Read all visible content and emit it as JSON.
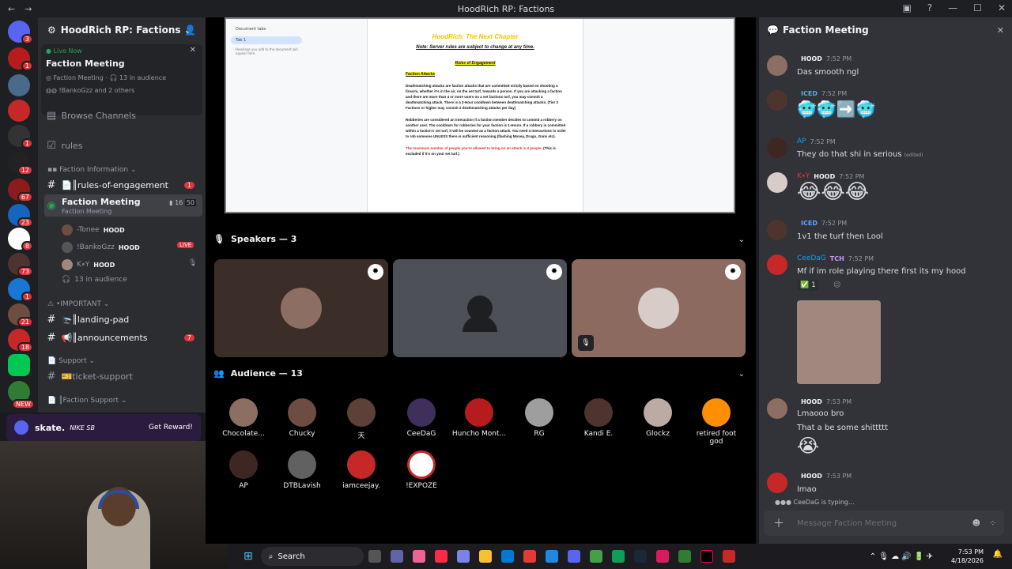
{
  "window": {
    "title": "HoodRich RP: Factions"
  },
  "rail": {
    "badges": [
      "3",
      "1",
      "1",
      "12",
      "67",
      "23",
      "8",
      "73",
      "1",
      "21",
      "18",
      "NEW"
    ]
  },
  "sidebar": {
    "server_name": "HoodRich RP: Factions",
    "live": {
      "label": "Live Now",
      "title": "Faction Meeting",
      "subtitle": "Faction Meeting",
      "audience": "13 in audience",
      "participants": "!BankoGzz and 2 others"
    },
    "browse": "Browse Channels",
    "rules": "rules",
    "cat_info": "Faction Information",
    "roe": "║rules-of-engagement",
    "roe_badge": "1",
    "stage_name": "Faction Meeting",
    "stage_sub": "Faction Meeting",
    "stage_count_a": "16",
    "stage_count_b": "50",
    "members": [
      {
        "name": "-Tonee",
        "tag": "HOOD"
      },
      {
        "name": "!BankoGzz",
        "tag": "HOOD",
        "live": "LIVE"
      },
      {
        "name": "K⭑Y",
        "tag": "HOOD"
      }
    ],
    "audience_count": "13 in audience",
    "cat_important": "•IMPORTANT",
    "landing": "║landing-pad",
    "announcements": "║announcements",
    "ann_badge": "7",
    "cat_support": "Support",
    "ticket": "ticket-support",
    "cat_faction_support": "║Faction Support"
  },
  "promo": {
    "brand": "skate.",
    "nike": "NIKE SB",
    "cta": "Get Reward!"
  },
  "doc": {
    "tabs_title": "Document tabs",
    "tab1": "Tab 1",
    "headings_note": "Headings you add to the document will appear here.",
    "heading": "HoodRich: The Next Chapter",
    "note": "Note: Server rules are subject to change at any time.",
    "roe_title": "Rules of Engagement",
    "attacks_title": "Faction Attacks",
    "rule1": "Deathmatching attacks are faction attacks that are committed strictly based on shooting a firearm, whether it's in the air, on the set turf, towards a person. If you are attacking a faction and there are more than 4 or more users on a set factions turf, you may commit a deathmatching attack. There is a 2-Hour cooldown between deathmatching attacks. (Tier 2 Factions or higher may commit 2 deathmatching attacks per day)",
    "rule2": "Robberies are considered an interaction if a faction member decides to commit a robbery on another user. The cooldown for robberies for your faction is 1-Hours. If a robbery is committed within a faction's set turf, it will be counted as a faction attack. You need 4 interactions in order to rob someone UNLESS there is sufficient reasoning (flashing Money, Drugs, Guns etc).",
    "rule3_red": "The maximum number of people you're allowed to bring on an attack is 4 people.",
    "rule3_black": "(This is excluded if it's on your set turf.)"
  },
  "stage": {
    "speakers_label": "Speakers — 3",
    "audience_label": "Audience — 13",
    "audience": [
      "Chocolate...",
      "Chucky",
      "天",
      "CeeDaG",
      "Huncho Mont...",
      "RG",
      "Kandi E.",
      "Glockz",
      "retired foot god",
      "AP",
      "DTBLavish",
      "iamceejay.",
      "!EXPOZE"
    ]
  },
  "chat": {
    "title": "Faction Meeting",
    "messages": [
      {
        "name": "",
        "tag": "HOOD",
        "time": "7:52 PM",
        "text": "Das smooth ngl"
      },
      {
        "name": "",
        "tag": "ICED",
        "time": "7:52 PM",
        "text": "🥶🥶➡️🥶"
      },
      {
        "name": "AP",
        "tag": "",
        "time": "7:52 PM",
        "text": "They do that shi in serious",
        "edited": "(edited)"
      },
      {
        "name": "K⭑Y",
        "tag": "HOOD",
        "time": "7:52 PM",
        "text": "😂😂😂"
      },
      {
        "name": "",
        "tag": "ICED",
        "time": "7:52 PM",
        "text": "1v1 the turf then Lool"
      },
      {
        "name": "CeeDaG",
        "tag": "TCH",
        "time": "7:52 PM",
        "text": "Mf if im role playing there first its my hood",
        "reaction": "1"
      },
      {
        "name": "",
        "tag": "HOOD",
        "time": "7:53 PM",
        "text": "Lmaooo bro",
        "text2": "That a be some shittttt",
        "text3": "😭"
      },
      {
        "name": "",
        "tag": "HOOD",
        "time": "7:53 PM",
        "text": "lmao"
      }
    ],
    "typing": "CeeDaG is typing...",
    "placeholder": "Message Faction Meeting"
  },
  "taskbar": {
    "search": "Search",
    "time": "7:53 PM",
    "date": "4/18/2026"
  },
  "colors": {
    "accent": "#5865f2",
    "green": "#23a55a",
    "red": "#da373c",
    "link": "#00a8fc"
  }
}
